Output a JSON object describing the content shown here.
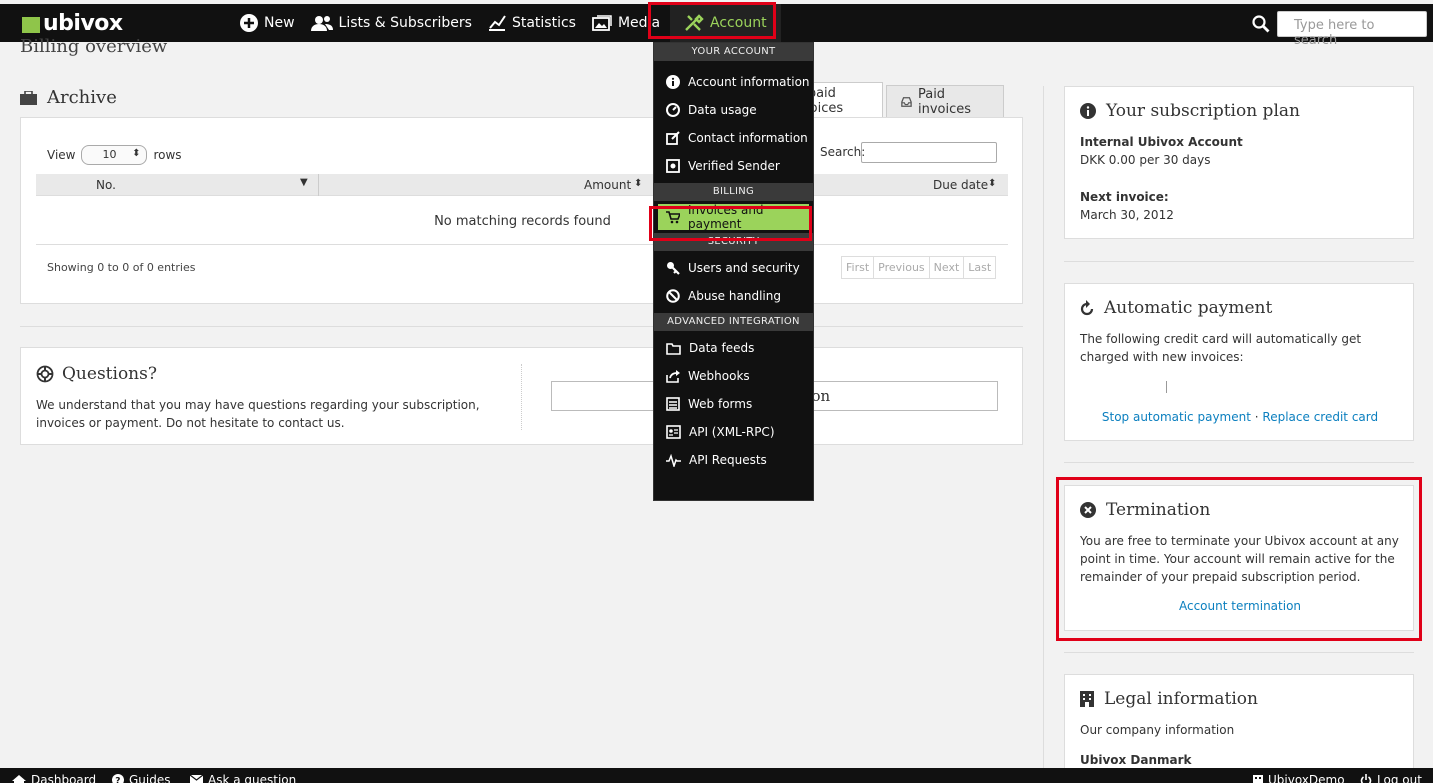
{
  "brand": {
    "name": "ubivox"
  },
  "nav": {
    "new": "New",
    "lists": "Lists & Subscribers",
    "statistics": "Statistics",
    "media": "Media",
    "account": "Account",
    "search_placeholder": "Type here to search"
  },
  "page": {
    "title": "Billing overview"
  },
  "archive": {
    "title": "Archive",
    "tab_unpaid": "Unpaid invoices",
    "tab_paid": "Paid invoices",
    "view_label": "View",
    "rows_value": "10",
    "rows_label": "rows",
    "search_label": "Search:",
    "columns": [
      "No.",
      "Amount",
      "Due date"
    ],
    "empty": "No matching records found",
    "showing": "Showing 0 to 0 of 0 entries",
    "pager": [
      "First",
      "Previous",
      "Next",
      "Last"
    ]
  },
  "questions": {
    "title": "Questions?",
    "text": "We understand that you may have questions regarding your subscription, invoices or payment. Do not hesitate to contact us.",
    "button": "Ask a question"
  },
  "dropdown": {
    "sections": [
      {
        "header": "YOUR ACCOUNT",
        "items": [
          {
            "label": "Account information",
            "icon": "info-icon"
          },
          {
            "label": "Data usage",
            "icon": "gauge-icon"
          },
          {
            "label": "Contact information",
            "icon": "edit-icon"
          },
          {
            "label": "Verified Sender",
            "icon": "certificate-icon"
          }
        ]
      },
      {
        "header": "BILLING",
        "items": [
          {
            "label": "Invoices and payment",
            "icon": "cart-icon"
          }
        ]
      },
      {
        "header": "SECURITY",
        "items": [
          {
            "label": "Users and security",
            "icon": "key-icon"
          },
          {
            "label": "Abuse handling",
            "icon": "ban-icon"
          }
        ]
      },
      {
        "header": "ADVANCED INTEGRATION",
        "items": [
          {
            "label": "Data feeds",
            "icon": "folder-icon"
          },
          {
            "label": "Webhooks",
            "icon": "share-icon"
          },
          {
            "label": "Web forms",
            "icon": "form-icon"
          },
          {
            "label": "API (XML-RPC)",
            "icon": "api-icon"
          },
          {
            "label": "API Requests",
            "icon": "pulse-icon"
          }
        ]
      }
    ]
  },
  "subscription": {
    "title": "Your subscription plan",
    "plan": "Internal Ubivox Account",
    "price": "DKK 0.00 per 30 days",
    "next_label": "Next invoice:",
    "next_date": "March 30, 2012"
  },
  "autopay": {
    "title": "Automatic payment",
    "text": "The following credit card will automatically get charged with new invoices:",
    "stop": "Stop automatic payment",
    "sep": "·",
    "replace": "Replace credit card"
  },
  "termination": {
    "title": "Termination",
    "text": "You are free to terminate your Ubivox account at any point in time. Your account will remain active for the remainder of your prepaid subscription period.",
    "link": "Account termination"
  },
  "legal": {
    "title": "Legal information",
    "text": "Our company information",
    "company": "Ubivox Danmark"
  },
  "footer": {
    "dashboard": "Dashboard",
    "guides": "Guides",
    "ask": "Ask a question",
    "user": "UbivoxDemo",
    "logout": "Log out"
  },
  "colors": {
    "accent": "#9bd35b",
    "highlight": "#e00018",
    "bar": "#111111"
  }
}
